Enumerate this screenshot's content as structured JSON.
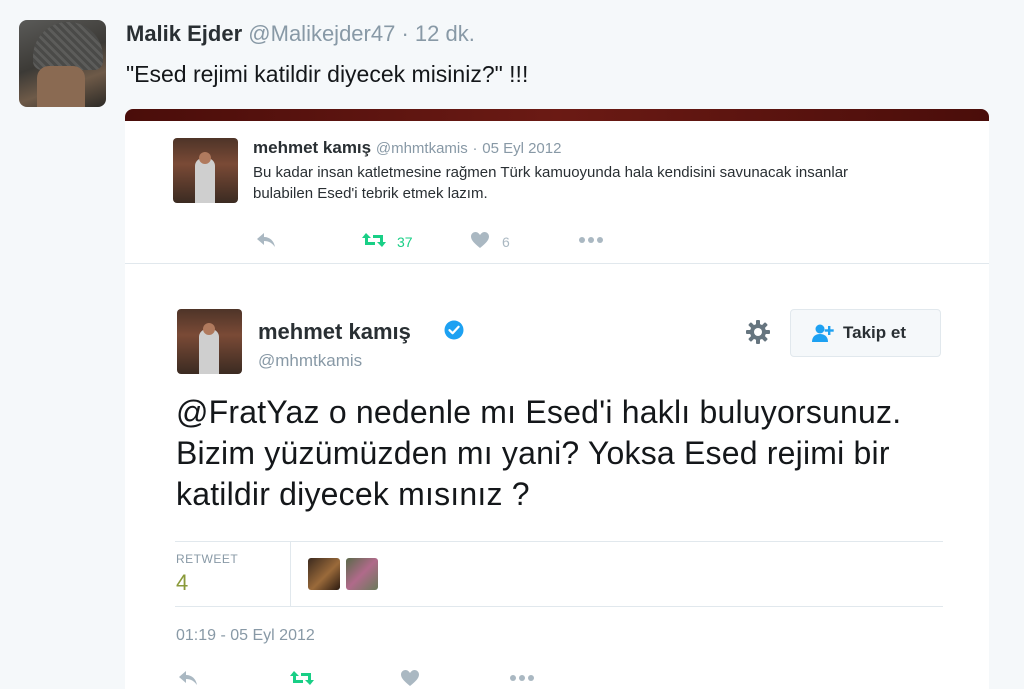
{
  "tweet": {
    "author_name": "Malik Ejder",
    "author_handle": "@Malikejder47",
    "separator": "·",
    "time": "12 dk.",
    "text": "\"Esed rejimi katildir diyecek misiniz?\" !!!"
  },
  "quoted_tweet": {
    "author_name": "mehmet kamış",
    "author_handle": "@mhmtkamis",
    "separator": "·",
    "date": "05 Eyl 2012",
    "text": "Bu kadar insan katletmesine rağmen Türk kamuoyunda hala kendisini savunacak insanlar bulabilen Esed'i tebrik etmek lazım.",
    "retweet_count": "37",
    "like_count": "6"
  },
  "main_tweet": {
    "author_name": "mehmet kamış",
    "author_handle": "@mhmtkamis",
    "follow_label": "Takip et",
    "text": "@FratYaz o nedenle mı Esed'i haklı buluyorsunuz. Bizim yüzümüzden mı yani? Yoksa Esed rejimi bir katildir diyecek mısınız ?",
    "retweet_label": "RETWEET",
    "retweet_count": "4",
    "timestamp": "01:19 - 05 Eyl 2012"
  },
  "icons": [
    "reply-icon",
    "retweet-icon",
    "like-icon",
    "more-icon",
    "verified-icon",
    "gear-icon",
    "follow-icon"
  ],
  "colors": {
    "accent": "#1da1f2",
    "retweet_green": "#19cf86",
    "muted": "#8899a6",
    "retweet_count_color": "#8a9a3a"
  }
}
